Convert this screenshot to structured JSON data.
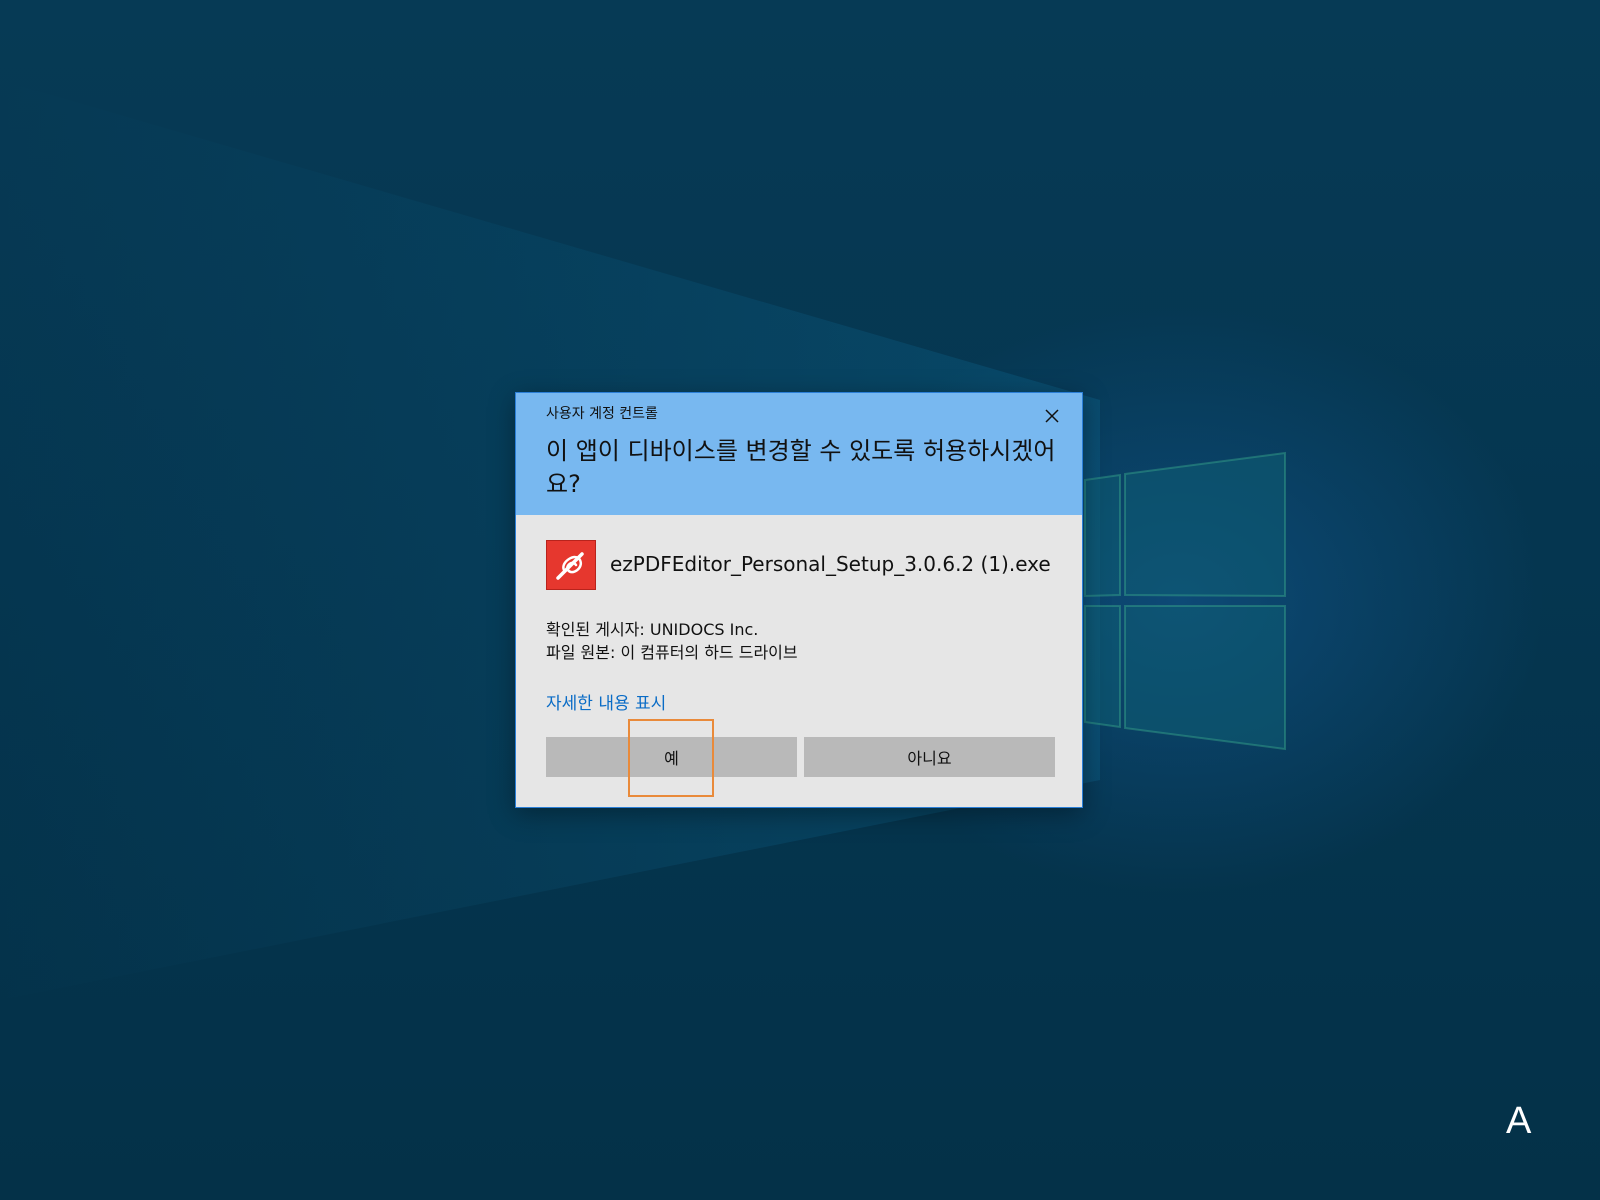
{
  "uac": {
    "caption": "사용자 계정 컨트롤",
    "question": "이 앱이 디바이스를 변경할 수 있도록 허용하시겠어요?",
    "app_name": "ezPDFEditor_Personal_Setup_3.0.6.2 (1).exe",
    "publisher_line": "확인된 게시자: UNIDOCS Inc.",
    "origin_line": "파일 원본: 이 컴퓨터의 하드 드라이브",
    "details_link": "자세한 내용 표시",
    "yes_label": "예",
    "no_label": "아니요",
    "icons": {
      "close": "close-icon",
      "app": "ezpdf-app-icon"
    },
    "colors": {
      "header": "#78b8f0",
      "body": "#e6e6e6",
      "button": "#b9b9b9",
      "link": "#0a6cc6",
      "focus": "#e98a3a",
      "app_icon": "#e6372e"
    }
  },
  "taskbar": {
    "input_indicator": "A"
  }
}
